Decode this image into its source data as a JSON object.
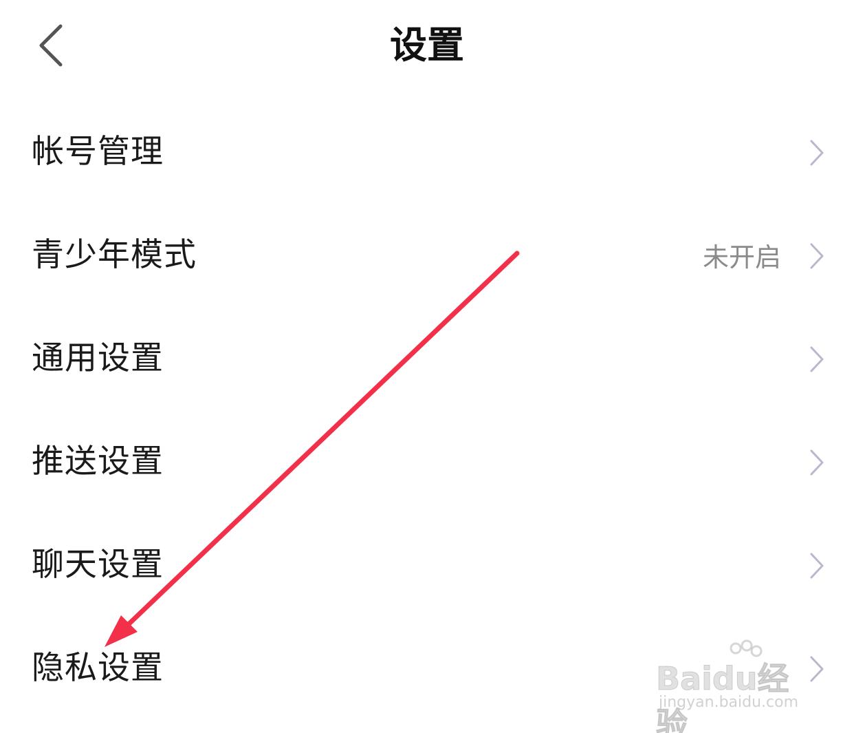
{
  "header": {
    "title": "设置",
    "back_icon": "chevron-left-icon"
  },
  "settings": {
    "items": [
      {
        "label": "帐号管理",
        "value": ""
      },
      {
        "label": "青少年模式",
        "value": "未开启"
      },
      {
        "label": "通用设置",
        "value": ""
      },
      {
        "label": "推送设置",
        "value": ""
      },
      {
        "label": "聊天设置",
        "value": ""
      },
      {
        "label": "隐私设置",
        "value": ""
      }
    ]
  },
  "colors": {
    "chevron": "#b9b7cc",
    "annotation_arrow": "#f2304a",
    "secondary_text": "#8a8a8a"
  },
  "watermark": {
    "brand": "Baidu经验",
    "url": "jingyan.baidu.com"
  }
}
